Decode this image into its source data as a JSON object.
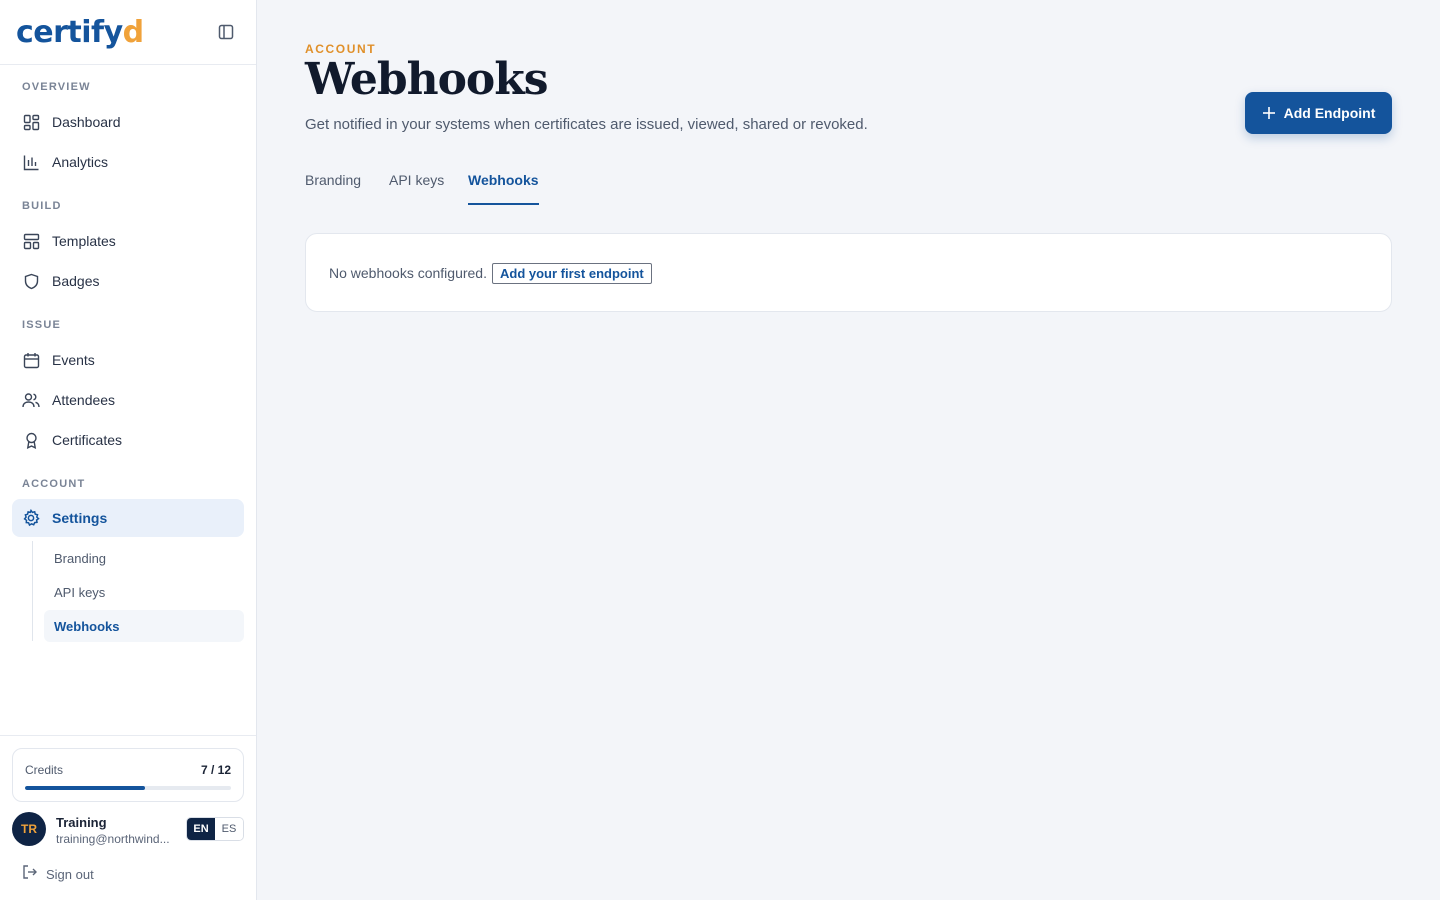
{
  "app": {
    "logo_main": "certify",
    "logo_accent": "d"
  },
  "sidebar": {
    "sections": {
      "overview": "OVERVIEW",
      "build": "BUILD",
      "issue": "ISSUE",
      "account": "ACCOUNT"
    },
    "items": {
      "dashboard": "Dashboard",
      "analytics": "Analytics",
      "templates": "Templates",
      "badges": "Badges",
      "events": "Events",
      "attendees": "Attendees",
      "certificates": "Certificates",
      "settings": "Settings"
    },
    "sub_items": {
      "branding": "Branding",
      "api_keys": "API keys",
      "webhooks": "Webhooks"
    },
    "credits": {
      "label": "Credits",
      "count": "7 / 12",
      "used": 7,
      "total": 12
    },
    "user": {
      "initials": "TR",
      "name": "Training",
      "email": "training@northwind..."
    },
    "languages": [
      "EN",
      "ES"
    ],
    "active_language": "EN",
    "sign_out": "Sign out"
  },
  "main": {
    "eyebrow": "ACCOUNT",
    "title": "Webhooks",
    "subtitle": "Get notified in your systems when certificates are issued, viewed, shared or revoked.",
    "add_button": "Add Endpoint",
    "tabs": [
      "Branding",
      "API keys",
      "Webhooks"
    ],
    "active_tab": "Webhooks",
    "empty_text": "No webhooks configured.",
    "empty_link": "Add your first endpoint"
  },
  "colors": {
    "brand": "#14549c",
    "accent": "#f0a23a",
    "eyebrow": "#e0902a"
  }
}
